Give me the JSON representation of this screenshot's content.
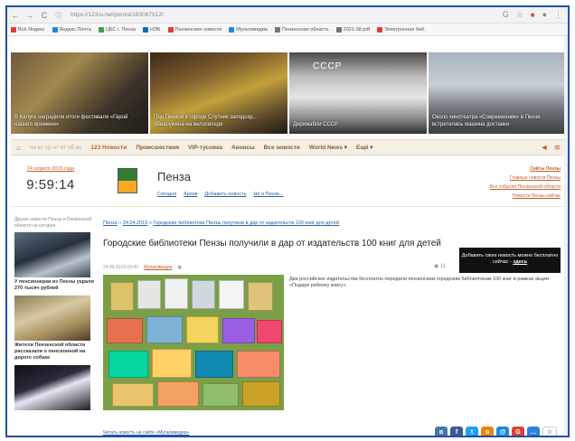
{
  "browser": {
    "url": "https://123ru.net/penza/183087512/",
    "bookmarks": [
      {
        "label": "Всё Яндекс",
        "color": "#e53935"
      },
      {
        "label": "Яндекс.Почта",
        "color": "#1e88e5"
      },
      {
        "label": "ЦБС г. Пенза",
        "color": "#43a047"
      },
      {
        "label": "НЭБ",
        "color": "#1565c0"
      },
      {
        "label": "Пензенские новости",
        "color": "#e53935"
      },
      {
        "label": "Мультимедиа",
        "color": "#1e88e5"
      },
      {
        "label": "Пензенская область",
        "color": "#757575"
      },
      {
        "label": "2021-08.pdf",
        "color": "#757575"
      },
      {
        "label": "Электронная биб.",
        "color": "#e53935"
      }
    ]
  },
  "hero": [
    {
      "caption": "В Калуге наградили итоги фестиваля «Герой нашего времени»"
    },
    {
      "caption": "Под Пензой в городе Спутник заподозр… обнаружена на велосипеде"
    },
    {
      "caption": "Дирижабли СССР",
      "stamp": "СССР"
    },
    {
      "caption": "Около кинотеатра «Современник» в Пензе встретилась машина доставки"
    }
  ],
  "nav": {
    "weekdays": "пн вт ср чт пт сб вс",
    "items": [
      "123 Новости",
      "Происшествия",
      "VIP-тусовка",
      "Анонсы",
      "Все новости",
      "World News ▾",
      "Ещё ▾"
    ]
  },
  "datebox": {
    "date": "24 апреля 2019 года",
    "time": "9:59:14"
  },
  "city": {
    "title": "Пенза",
    "links": [
      "Сегодня",
      "Архив",
      "Добавить новость",
      "Не в Пензе..."
    ]
  },
  "right_links": [
    "Сайты Пензы",
    "Главные новости Пензы",
    "Все события Пензенской области",
    "Новости Пензы сейчас"
  ],
  "sidebar": {
    "meta": "Другие новости Пензы и Пензенской области на сегодня",
    "items": [
      {
        "caption": "У пенсионерки из Пензы украли 270 тысяч рублей"
      },
      {
        "caption": "Жители Пензенской области рассказали о пенсионной на дороге собаке"
      },
      {
        "caption": ""
      }
    ]
  },
  "article": {
    "breadcrumb": [
      "Пенза",
      "24.04.2019",
      "Городские библиотеки Пензы получили в дар от издательств 100 книг для детей"
    ],
    "title": "Городские библиотеки Пензы получили в дар от издательств 100 книг для детей",
    "date": "24.04.2019 09:40",
    "author": "Мультимедиа",
    "views": "11",
    "text": "Два российских издательства бесплатно передали пензенским городским библиотекам 100 книг в рамках акции «Подари ребенку книгу».",
    "share_hint": "Читать новость на сайте «Мультимедиа»"
  },
  "promo": {
    "text": "Добавить свою новость можно бесплатно сейчас -",
    "link": "здесь"
  },
  "social": {
    "count": "0",
    "buttons": [
      {
        "name": "vk",
        "letter": "в",
        "color": "#4a76a8"
      },
      {
        "name": "facebook",
        "letter": "f",
        "color": "#3b5998"
      },
      {
        "name": "twitter",
        "letter": "t",
        "color": "#1da1f2"
      },
      {
        "name": "odnoklassniki",
        "letter": "о",
        "color": "#ee8208"
      },
      {
        "name": "mailru",
        "letter": "@",
        "color": "#168de2"
      },
      {
        "name": "google",
        "letter": "G",
        "color": "#db4437"
      },
      {
        "name": "more",
        "letter": "…",
        "color": "#2a83d9"
      }
    ]
  }
}
